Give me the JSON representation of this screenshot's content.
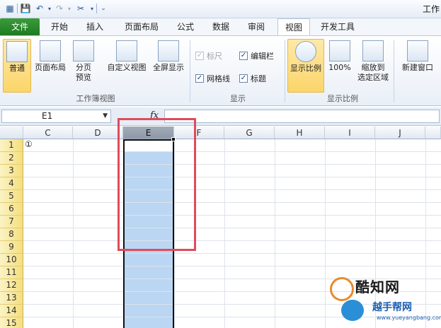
{
  "qat": {
    "title": "工作"
  },
  "tabs": [
    {
      "label": "文件"
    },
    {
      "label": "开始"
    },
    {
      "label": "插入"
    },
    {
      "label": "页面布局"
    },
    {
      "label": "公式"
    },
    {
      "label": "数据"
    },
    {
      "label": "审阅"
    },
    {
      "label": "视图"
    },
    {
      "label": "开发工具"
    }
  ],
  "ribbon": {
    "workbook_views": {
      "label": "工作簿视图",
      "normal": "普通",
      "page_layout": "页面布局",
      "page_break_1": "分页",
      "page_break_2": "预览",
      "custom_view": "自定义视图",
      "full_screen": "全屏显示"
    },
    "show": {
      "label": "显示",
      "ruler": "标尺",
      "formula_bar": "编辑栏",
      "gridlines": "网格线",
      "headings": "标题"
    },
    "zoom": {
      "label": "显示比例",
      "zoom": "显示比例",
      "hundred": "100%",
      "zoom_sel_1": "缩放到",
      "zoom_sel_2": "选定区域"
    },
    "window": {
      "new_window": "新建窗口"
    }
  },
  "formula_bar": {
    "name_box": "E1",
    "fx": "fx"
  },
  "columns": [
    "C",
    "D",
    "E",
    "F",
    "G",
    "H",
    "I",
    "J"
  ],
  "rows": [
    "1",
    "2",
    "3",
    "4",
    "5",
    "6",
    "7",
    "8",
    "9",
    "10",
    "11",
    "12",
    "13",
    "14",
    "15"
  ],
  "cells": {
    "C1": "①"
  },
  "watermark": {
    "brand": "酷知网",
    "sub": "越手帮网",
    "url": "www.yueyangbang.com"
  }
}
